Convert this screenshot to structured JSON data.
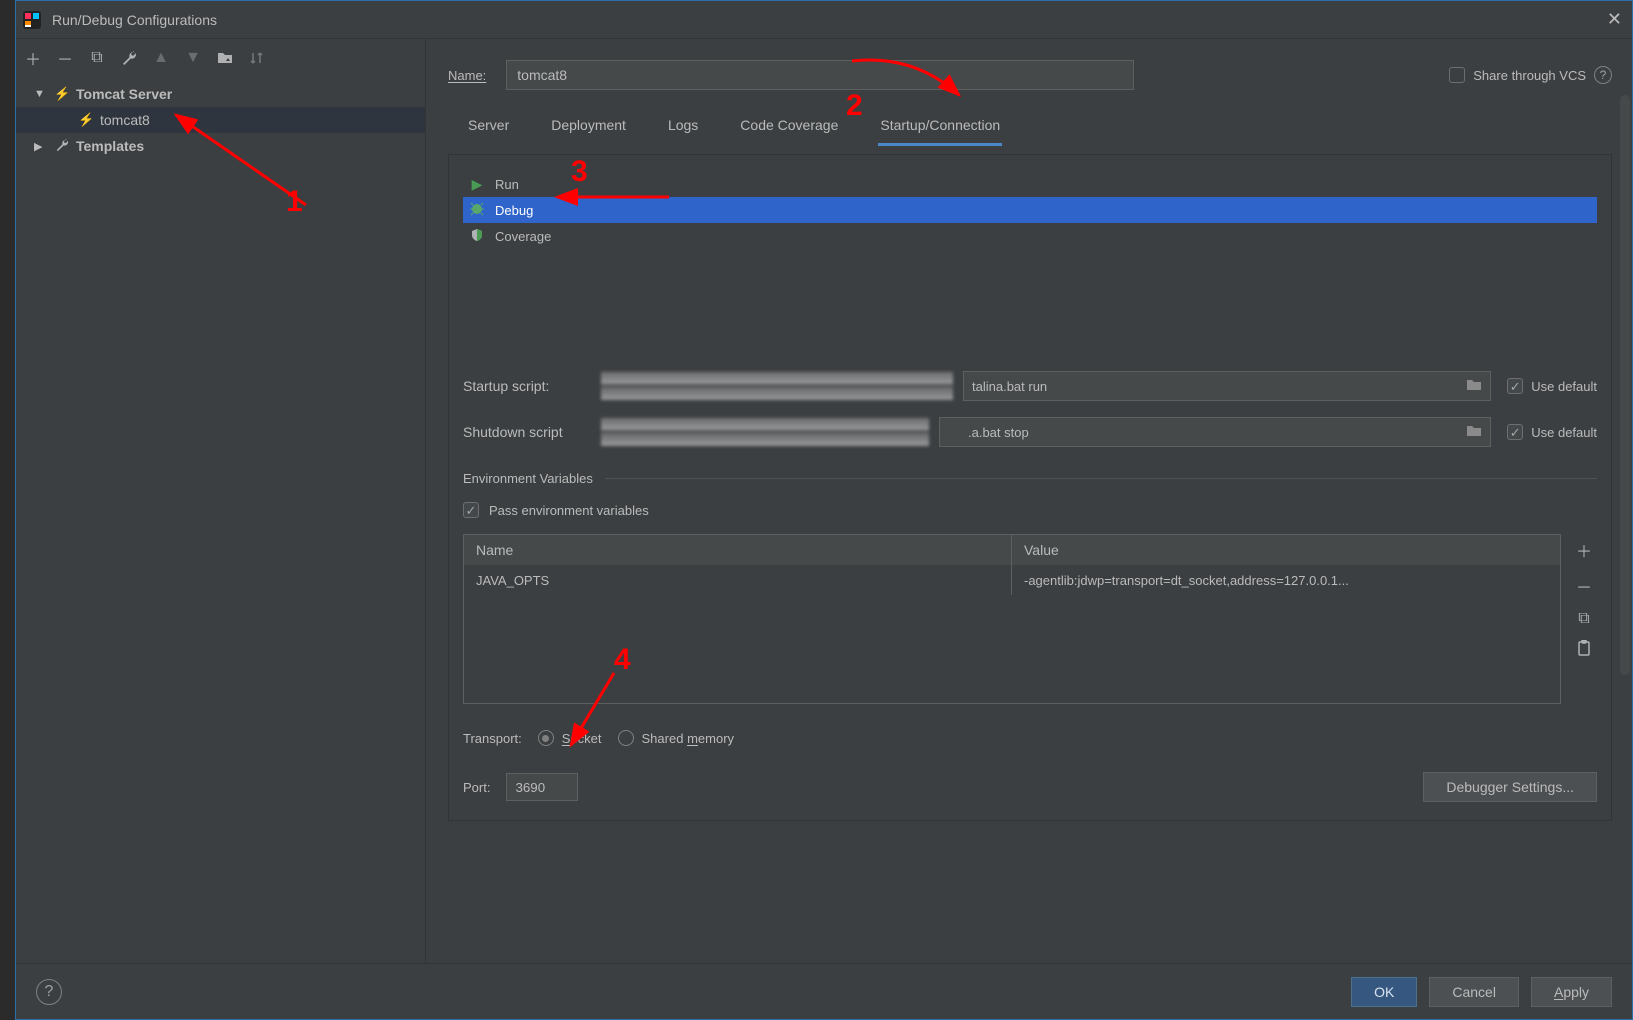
{
  "window": {
    "title": "Run/Debug Configurations"
  },
  "sidebar": {
    "tree": {
      "server_group": "Tomcat Server",
      "config_name": "tomcat8",
      "templates": "Templates"
    }
  },
  "main": {
    "name_label": "Name:",
    "name_value": "tomcat8",
    "share_vcs": "Share through VCS",
    "tabs": [
      "Server",
      "Deployment",
      "Logs",
      "Code Coverage",
      "Startup/Connection"
    ],
    "modes": {
      "run": "Run",
      "debug": "Debug",
      "coverage": "Coverage"
    },
    "startup_script_label": "Startup script:",
    "startup_script_value": "talina.bat run",
    "shutdown_script_label": "Shutdown script",
    "shutdown_script_value": ".a.bat stop",
    "use_default": "Use default",
    "env_section": "Environment Variables",
    "pass_env": "Pass environment variables",
    "env_table": {
      "head_name": "Name",
      "head_value": "Value",
      "rows": [
        {
          "name": "JAVA_OPTS",
          "value": "-agentlib:jdwp=transport=dt_socket,address=127.0.0.1..."
        }
      ]
    },
    "transport_label": "Transport:",
    "transport_socket": "Socket",
    "transport_shared": "Shared memory",
    "port_label": "Port:",
    "port_value": "3690",
    "debugger_settings": "Debugger Settings..."
  },
  "footer": {
    "ok": "OK",
    "cancel": "Cancel",
    "apply": "Apply"
  },
  "annotations": {
    "n1": "1",
    "n2": "2",
    "n3": "3",
    "n4": "4"
  }
}
